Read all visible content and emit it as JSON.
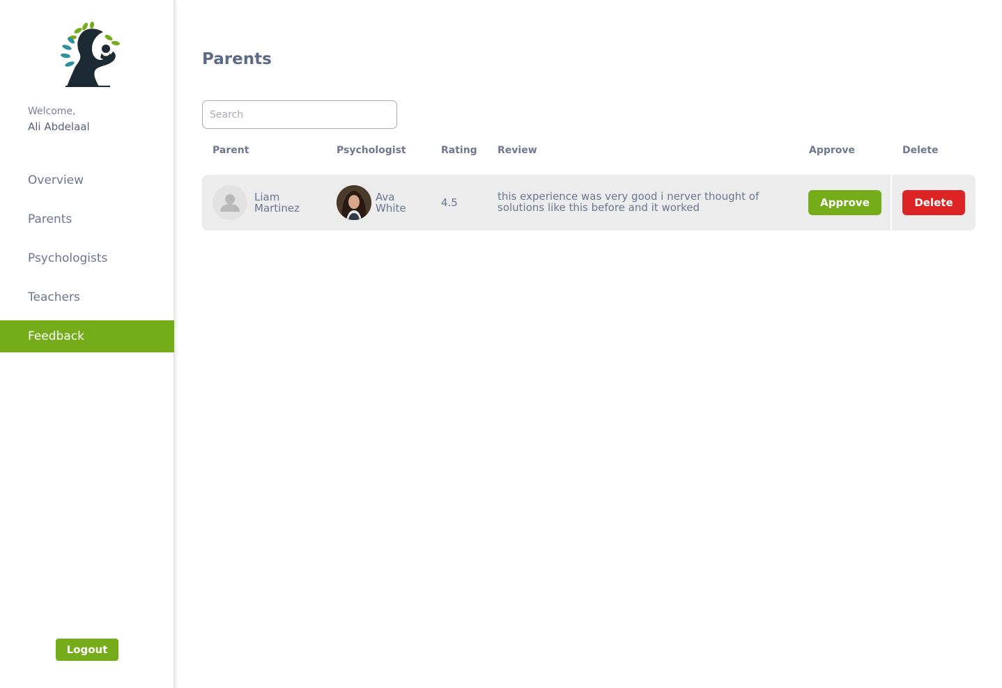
{
  "sidebar": {
    "logo_icon": "mother-child-tree-logo",
    "welcome": "Welcome,",
    "username": "Ali Abdelaal",
    "nav": [
      {
        "label": "Overview",
        "active": false
      },
      {
        "label": "Parents",
        "active": false
      },
      {
        "label": "Psychologists",
        "active": false
      },
      {
        "label": "Teachers",
        "active": false
      },
      {
        "label": "Feedback",
        "active": true
      }
    ],
    "logout_label": "Logout"
  },
  "main": {
    "title": "Parents",
    "search": {
      "placeholder": "Search",
      "value": ""
    },
    "columns": [
      "Parent",
      "Psychologist",
      "Rating",
      "Review",
      "Approve",
      "Delete"
    ],
    "rows": [
      {
        "parent_first": "Liam",
        "parent_last": "Martinez",
        "parent_avatar": "default-user-icon",
        "psych_first": "Ava",
        "psych_last": "White",
        "psych_avatar": "profile-photo",
        "rating": "4.5",
        "review": "this experience was very good i nerver thought of solutions like this before and it worked",
        "approve_label": "Approve",
        "delete_label": "Delete"
      }
    ]
  },
  "colors": {
    "accent_green": "#74ac1a",
    "delete_red": "#dc2424",
    "text": "#6b7590",
    "row_bg": "#ececec"
  }
}
